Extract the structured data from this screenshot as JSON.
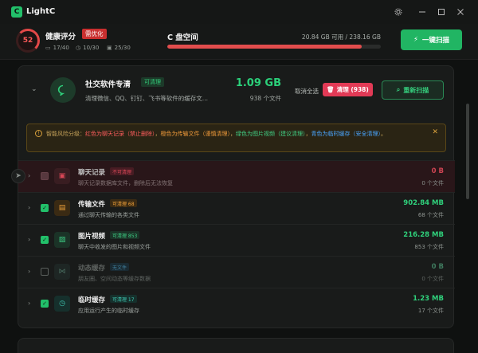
{
  "app": {
    "title": "LightC",
    "logo_letter": "C"
  },
  "window": {
    "settings_icon": "gear-icon",
    "minimize_icon": "minimize-icon",
    "maximize_icon": "maximize-icon",
    "close_icon": "close-icon"
  },
  "health": {
    "score": "52",
    "label": "健康评分",
    "badge": "需优化",
    "stats": [
      {
        "icon": "folder-icon",
        "text": "17/40"
      },
      {
        "icon": "clock-icon",
        "text": "10/30"
      },
      {
        "icon": "archive-icon",
        "text": "25/30"
      }
    ]
  },
  "disk": {
    "label": "C 盘空间",
    "info": "20.84 GB 可用 / 238.16 GB",
    "used_fraction": 0.912
  },
  "scan_button": {
    "label": "一键扫描",
    "icon": "lightning-icon"
  },
  "category": {
    "title": "社交软件专清",
    "badge": "可清理",
    "description": "清理微信、QQ、钉钉、飞书等软件的缓存文...",
    "size": "1.09 GB",
    "count": "938 个文件",
    "deselect_label": "取消全选",
    "clean_label": "清理 (938)",
    "rescan_label": "重新扫描",
    "icon": "chat-bubble-icon"
  },
  "warning": {
    "prefix": "智能风险分级：",
    "red": "红色为聊天记录（禁止删除）",
    "sep1": "，",
    "orange": "橙色为传输文件（谨慎清理）",
    "sep2": "，",
    "green": "绿色为图片视频（建议清理）",
    "sep3": "，",
    "blue": "青色为临时缓存（安全清理）",
    "suffix": "。"
  },
  "rows": [
    {
      "title": "聊天记录",
      "badge": "不可清理",
      "desc": "聊天记录数据库文件，删除后无法恢复",
      "size": "0 B",
      "count": "0 个文件",
      "icon": "lock-icon"
    },
    {
      "title": "传输文件",
      "badge": "可清理 68",
      "desc": "通过聊天传输的各类文件",
      "size": "902.84 MB",
      "count": "68 个文件",
      "icon": "file-icon"
    },
    {
      "title": "图片视频",
      "badge": "可清理 853",
      "desc": "聊天中收发的图片和视频文件",
      "size": "216.28 MB",
      "count": "853 个文件",
      "icon": "image-icon"
    },
    {
      "title": "动态缓存",
      "badge": "无文件",
      "desc": "朋友圈、空间动态等缓存数据",
      "size": "0 B",
      "count": "0 个文件",
      "icon": "share-icon"
    },
    {
      "title": "临时缓存",
      "badge": "可清理 17",
      "desc": "应用运行产生的临时缓存",
      "size": "1.23 MB",
      "count": "17 个文件",
      "icon": "clock-icon"
    }
  ],
  "colors": {
    "accent": "#22c06a",
    "danger": "#e23a56",
    "warning": "#d9a13c"
  }
}
